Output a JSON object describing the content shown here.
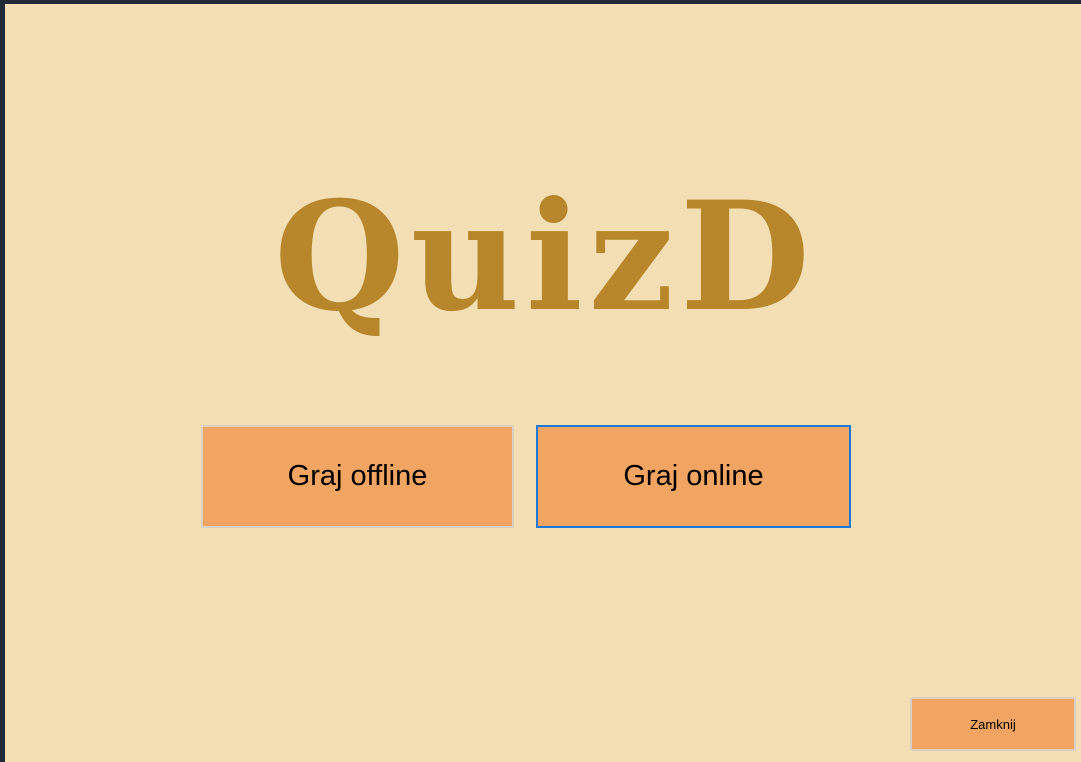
{
  "logo": {
    "text": "QuizD",
    "color": "#b8862b"
  },
  "buttons": {
    "offline_label": "Graj offline",
    "online_label": "Graj online",
    "close_label": "Zamknij"
  },
  "colors": {
    "background": "#f4deb3",
    "button": "#f2a462",
    "focus_border": "#1e79d6"
  }
}
